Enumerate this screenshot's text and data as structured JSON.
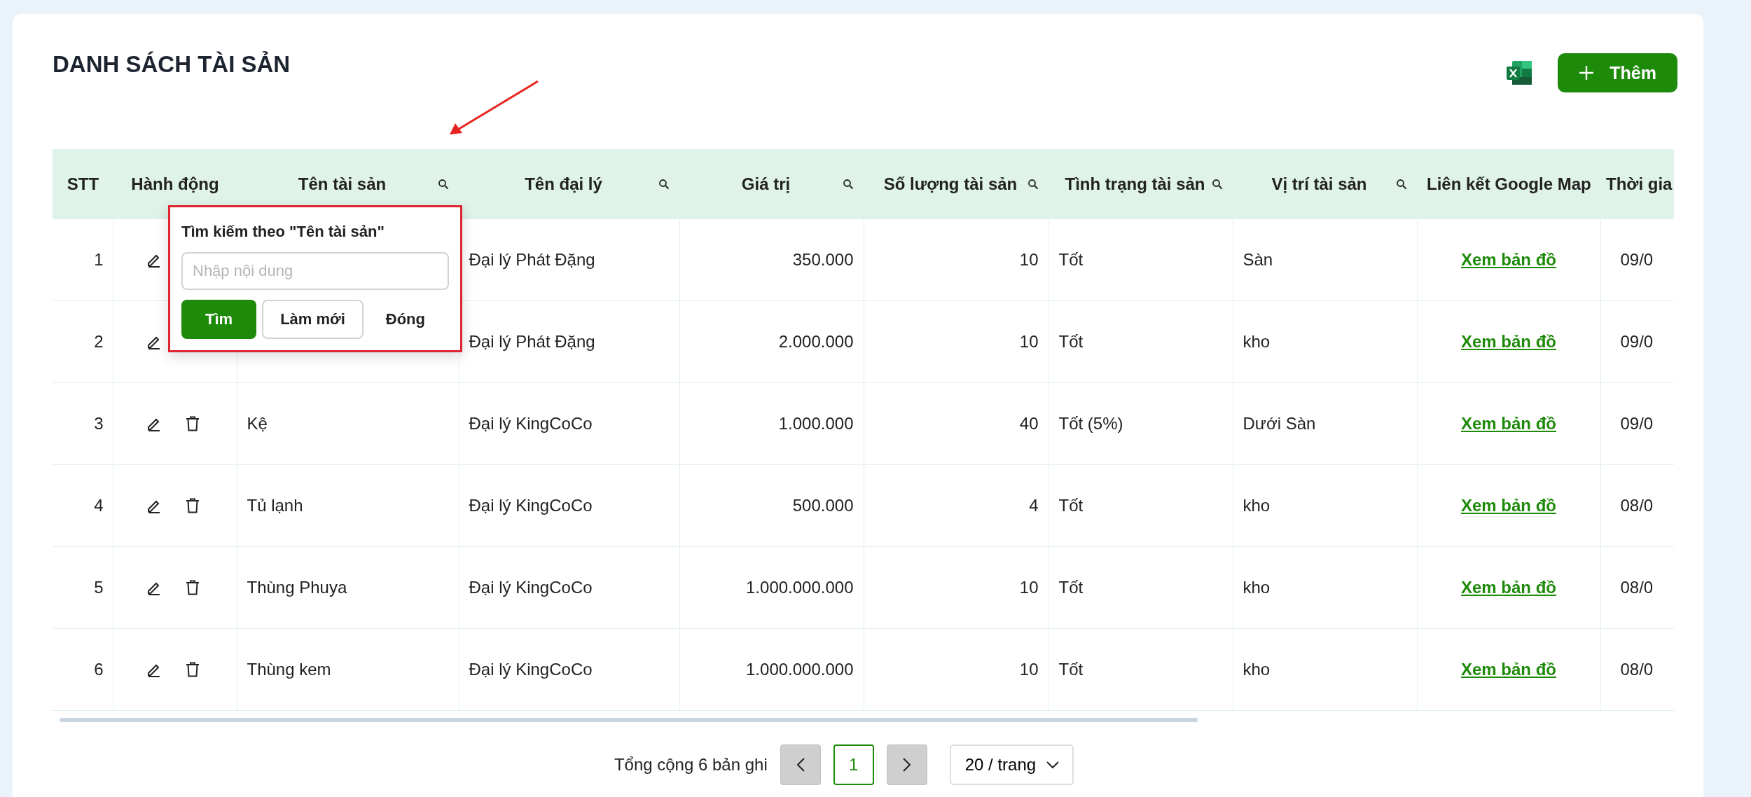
{
  "page": {
    "title": "DANH SÁCH TÀI SẢN",
    "add_button": "Thêm"
  },
  "table": {
    "columns": [
      {
        "label": "STT",
        "searchable": false
      },
      {
        "label": "Hành động",
        "searchable": false
      },
      {
        "label": "Tên tài sản",
        "searchable": true
      },
      {
        "label": "Tên đại lý",
        "searchable": true
      },
      {
        "label": "Giá trị",
        "searchable": true
      },
      {
        "label": "Số lượng tài sản",
        "searchable": true
      },
      {
        "label": "Tình trạng tài sản",
        "searchable": true
      },
      {
        "label": "Vị trí tài sản",
        "searchable": true
      },
      {
        "label": "Liên kết Google Map"
      },
      {
        "label": "Thời gia"
      }
    ],
    "rows": [
      {
        "stt": "1",
        "actions": [
          {
            "kind": "edit"
          }
        ],
        "agent": "Đại lý Phát Đặng",
        "value": "350.000",
        "quantity": "10",
        "condition": "Tốt",
        "location": "Sàn",
        "map_link": "Xem bản đồ",
        "time": "09/0"
      },
      {
        "stt": "2",
        "actions": [
          {
            "kind": "edit"
          }
        ],
        "agent": "Đại lý Phát Đặng",
        "value": "2.000.000",
        "quantity": "10",
        "condition": "Tốt",
        "location": "kho",
        "map_link": "Xem bản đồ",
        "time": "09/0"
      },
      {
        "stt": "3",
        "actions": [
          {
            "kind": "edit"
          },
          {
            "kind": "delete"
          }
        ],
        "name": "Kệ",
        "agent": "Đại lý KingCoCo",
        "value": "1.000.000",
        "quantity": "40",
        "condition": "Tốt (5%)",
        "location": "Dưới Sàn",
        "map_link": "Xem bản đồ",
        "time": "09/0"
      },
      {
        "stt": "4",
        "actions": [
          {
            "kind": "edit"
          },
          {
            "kind": "delete"
          }
        ],
        "name": "Tủ lạnh",
        "agent": "Đại lý KingCoCo",
        "value": "500.000",
        "quantity": "4",
        "condition": "Tốt",
        "location": "kho",
        "map_link": "Xem bản đồ",
        "time": "08/0"
      },
      {
        "stt": "5",
        "actions": [
          {
            "kind": "edit"
          },
          {
            "kind": "delete"
          }
        ],
        "name": "Thùng Phuya",
        "agent": "Đại lý KingCoCo",
        "value": "1.000.000.000",
        "quantity": "10",
        "condition": "Tốt",
        "location": "kho",
        "map_link": "Xem bản đồ",
        "time": "08/0"
      },
      {
        "stt": "6",
        "actions": [
          {
            "kind": "edit"
          },
          {
            "kind": "delete"
          }
        ],
        "name": "Thùng kem",
        "agent": "Đại lý KingCoCo",
        "value": "1.000.000.000",
        "quantity": "10",
        "condition": "Tốt",
        "location": "kho",
        "map_link": "Xem bản đồ",
        "time": "08/0"
      }
    ]
  },
  "filter_popup": {
    "title": "Tìm kiếm theo \"Tên tài sản\"",
    "placeholder": "Nhập nội dung",
    "buttons": [
      {
        "label": "Tìm",
        "kind": "primary"
      },
      {
        "label": "Làm mới",
        "kind": "default"
      },
      {
        "label": "Đóng",
        "kind": "text"
      }
    ]
  },
  "pagination": {
    "total": "Tổng cộng 6 bản ghi",
    "pages": [
      {
        "label": "1",
        "selected": true
      }
    ],
    "page_size": "20 / trang"
  }
}
